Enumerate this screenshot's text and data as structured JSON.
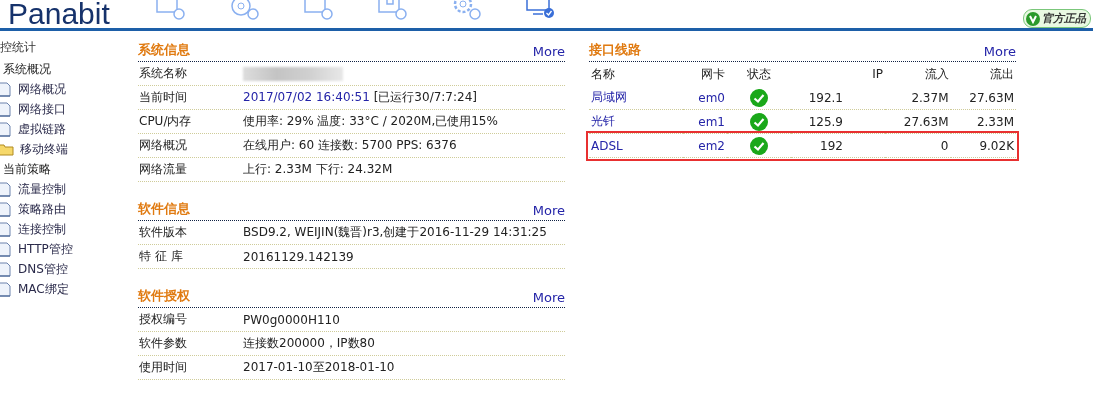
{
  "header": {
    "logo": "Panabit",
    "nav": [
      {
        "kind": "box",
        "selected": false
      },
      {
        "kind": "disc",
        "selected": false
      },
      {
        "kind": "box",
        "selected": false
      },
      {
        "kind": "puzzle",
        "selected": false
      },
      {
        "kind": "gear",
        "selected": false
      },
      {
        "kind": "monitor",
        "selected": true
      }
    ],
    "badge": "官方正品"
  },
  "sidebar": {
    "title": "控统计",
    "groups": [
      {
        "label": "系统概况",
        "children": [
          {
            "label": "网络概况",
            "kind": "page"
          },
          {
            "label": "网络接口",
            "kind": "page"
          },
          {
            "label": "虚拟链路",
            "kind": "page"
          },
          {
            "label": "移动终端",
            "kind": "folder"
          }
        ]
      },
      {
        "label": "当前策略",
        "children": [
          {
            "label": "流量控制",
            "kind": "page"
          },
          {
            "label": "策略路由",
            "kind": "page"
          },
          {
            "label": "连接控制",
            "kind": "page"
          },
          {
            "label": "HTTP管控",
            "kind": "page"
          },
          {
            "label": "DNS管控",
            "kind": "page"
          },
          {
            "label": "MAC绑定",
            "kind": "page"
          }
        ]
      }
    ]
  },
  "sections": [
    {
      "title": "系统信息",
      "more": "More",
      "rows": [
        {
          "label": "系统名称",
          "redacted": true
        },
        {
          "label": "当前时间",
          "value": "2017/07/02 16:40:51",
          "extra": " [已运行30/7:7:24]"
        },
        {
          "label": "CPU/内存",
          "value": "使用率: 29%   温度: 33°C  / 2020M,已使用15%"
        },
        {
          "label": "网络概况",
          "value": "在线用户: 60   连接数: 5700    PPS: 6376"
        },
        {
          "label": "网络流量",
          "value": "上行: 2.33M  下行: 24.32M"
        }
      ]
    },
    {
      "title": "软件信息",
      "more": "More",
      "rows": [
        {
          "label": "软件版本",
          "value": "BSD9.2, WEIJIN(魏晋)r3,创建于2016-11-29 14:31:25"
        },
        {
          "label": "特 征 库",
          "value": "20161129.142139"
        }
      ]
    },
    {
      "title": "软件授权",
      "more": "More",
      "rows": [
        {
          "label": "授权编号",
          "value": "PW0g0000H110"
        },
        {
          "label": "软件参数",
          "value": "连接数200000，IP数80"
        },
        {
          "label": "使用时间",
          "value": "2017-01-10至2018-01-10"
        }
      ]
    }
  ],
  "interfaces": {
    "title": "接口线路",
    "more": "More",
    "columns": [
      "名称",
      "网卡",
      "状态",
      "IP",
      "流入",
      "流出"
    ],
    "rows": [
      {
        "name": "局域网",
        "nic": "em0",
        "kind": "ok",
        "ip": "192.1",
        "in": "2.37M",
        "out": "27.63M",
        "highlighted": false
      },
      {
        "name": "光钎",
        "nic": "em1",
        "kind": "ok",
        "ip": "125.9",
        "in": "27.63M",
        "out": "2.33M",
        "highlighted": false
      },
      {
        "name": "ADSL",
        "nic": "em2",
        "kind": "ok",
        "ip": "192",
        "in": "0",
        "out": "9.02K",
        "highlighted": true
      }
    ]
  }
}
